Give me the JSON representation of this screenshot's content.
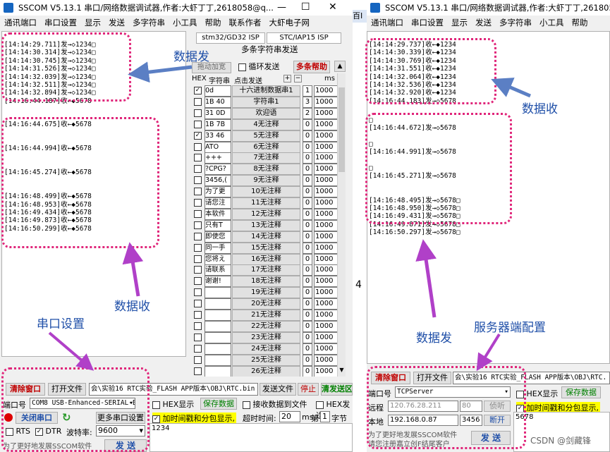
{
  "left": {
    "title": "SSCOM V5.13.1 串口/网络数据调试器,作者:大虾丁丁,2618058@q...",
    "menu": [
      "通讯端口",
      "串口设置",
      "显示",
      "发送",
      "多字符串",
      "小工具",
      "帮助",
      "联系作者",
      "大虾电子网"
    ],
    "log_top": [
      "[14:14:29.711]发→◇1234□",
      "[14:14:30.314]发→◇1234□",
      "[14:14:30.745]发→◇1234□",
      "[14:14:31.526]发→◇1234□",
      "[14:14:32.039]发→◇1234□",
      "[14:14:32.511]发→◇1234□",
      "[14:14:32.894]发→◇1234□",
      "[14:16:44.187]收←◆5678"
    ],
    "log_bottom": [
      "",
      "[14:16:44.675]收←◆5678",
      "",
      "",
      "[14:16:44.994]收←◆5678",
      "",
      "",
      "[14:16:45.274]收←◆5678",
      "",
      "",
      "[14:16:48.499]收←◆5678",
      "[14:16:48.953]收←◆5678",
      "[14:16:49.434]收←◆5678",
      "[14:16:49.873]收←◆5678",
      "[14:16:50.299]收←◆5678"
    ],
    "bottom": {
      "clear": "清除窗口",
      "open_file": "打开文件",
      "path": "会\\实验16 RTC实验_FLASH APP版本\\OBJ\\RTC.bin",
      "send_file": "发送文件",
      "stop": "停止",
      "clear_send": "清发送区",
      "port_label": "端口号",
      "port_value": "COM8 USB-Enhanced-SERIAL-B",
      "hex_display": "HEX显示",
      "save_data": "保存数据",
      "recv_to_file": "接收数据到文件",
      "hex_send": "HEX发送",
      "close_port": "关闭串口",
      "more_settings": "更多串口设置",
      "timestamp": "加时间戳和分包显示,",
      "timeout": "超时时间:",
      "timeout_val": "20",
      "ms": "ms",
      "nth": "第",
      "nth_val": "1",
      "byte": "字节",
      "rts": "RTS",
      "dtr": "DTR",
      "baud_label": "波特率:",
      "baud": "9600",
      "send_text": "1234",
      "promo": "为了更好地发展SSCOM软件",
      "send": "发 送"
    }
  },
  "multi": {
    "tab1": "stm32/GD32 ISP",
    "tab2": "STC/IAP15 ISP",
    "header": "多条字符串发送",
    "collapse": "拖动加宽",
    "loop": "循环发送",
    "help": "多条帮助",
    "col_hex": "HEX",
    "col_str": "字符串",
    "col_click": "点击发送",
    "col_ms": "ms",
    "rows": [
      {
        "chk": true,
        "text": "0d",
        "btn": "十六进制数据串1",
        "n": "1",
        "ms": "1000"
      },
      {
        "chk": false,
        "text": "1B 40",
        "btn": "字符串1",
        "n": "3",
        "ms": "1000"
      },
      {
        "chk": false,
        "text": "31 0D",
        "btn": "欢迎语",
        "n": "2",
        "ms": "1000"
      },
      {
        "chk": false,
        "text": "1B 7B",
        "btn": "4无注释",
        "n": "0",
        "ms": "1000"
      },
      {
        "chk": true,
        "text": "33 46",
        "btn": "5无注释",
        "n": "0",
        "ms": "1000"
      },
      {
        "chk": false,
        "text": "ATO",
        "btn": "6无注释",
        "n": "0",
        "ms": "1000"
      },
      {
        "chk": false,
        "text": "+++",
        "btn": "7无注释",
        "n": "0",
        "ms": "1000"
      },
      {
        "chk": false,
        "text": "?CPG?",
        "btn": "8无注释",
        "n": "0",
        "ms": "1000"
      },
      {
        "chk": false,
        "text": "3456,(",
        "btn": "9无注释",
        "n": "0",
        "ms": "1000"
      },
      {
        "chk": false,
        "text": "为了更",
        "btn": "10无注释",
        "n": "0",
        "ms": "1000"
      },
      {
        "chk": false,
        "text": "请您注",
        "btn": "11无注释",
        "n": "0",
        "ms": "1000"
      },
      {
        "chk": false,
        "text": "本软件",
        "btn": "12无注释",
        "n": "0",
        "ms": "1000"
      },
      {
        "chk": false,
        "text": "只有T",
        "btn": "13无注释",
        "n": "0",
        "ms": "1000"
      },
      {
        "chk": false,
        "text": "即使您",
        "btn": "14无注释",
        "n": "0",
        "ms": "1000"
      },
      {
        "chk": false,
        "text": "同一手",
        "btn": "15无注释",
        "n": "0",
        "ms": "1000"
      },
      {
        "chk": false,
        "text": "您将え",
        "btn": "16无注释",
        "n": "0",
        "ms": "1000"
      },
      {
        "chk": false,
        "text": "请联系",
        "btn": "17无注释",
        "n": "0",
        "ms": "1000"
      },
      {
        "chk": false,
        "text": "谢谢!",
        "btn": "18无注释",
        "n": "0",
        "ms": "1000"
      },
      {
        "chk": false,
        "text": "",
        "btn": "19无注释",
        "n": "0",
        "ms": "1000"
      },
      {
        "chk": false,
        "text": "",
        "btn": "20无注释",
        "n": "0",
        "ms": "1000"
      },
      {
        "chk": false,
        "text": "",
        "btn": "21无注释",
        "n": "0",
        "ms": "1000"
      },
      {
        "chk": false,
        "text": "",
        "btn": "22无注释",
        "n": "0",
        "ms": "1000"
      },
      {
        "chk": false,
        "text": "",
        "btn": "23无注释",
        "n": "0",
        "ms": "1000"
      },
      {
        "chk": false,
        "text": "",
        "btn": "24无注释",
        "n": "0",
        "ms": "1000"
      },
      {
        "chk": false,
        "text": "",
        "btn": "25无注释",
        "n": "0",
        "ms": "1000"
      },
      {
        "chk": false,
        "text": "",
        "btn": "26无注释",
        "n": "0",
        "ms": "1000"
      }
    ]
  },
  "mid": {
    "tab": "百I",
    "digit": "4"
  },
  "right": {
    "title": "SSCOM V5.13.1 串口/网络数据调试器,作者:大虾丁丁,2618058@",
    "menu": [
      "通讯端口",
      "串口设置",
      "显示",
      "发送",
      "多字符串",
      "小工具",
      "帮助"
    ],
    "log_top": [
      "[14:14:29.737]收←◆1234",
      "[14:14:30.339]收←◆1234",
      "[14:14:30.769]收←◆1234",
      "[14:14:31.551]收←◆1234",
      "[14:14:32.064]收←◆1234",
      "[14:14:32.536]收←◆1234",
      "[14:14:32.920]收←◆1234",
      "[14:16:44.183]发→◇5678"
    ],
    "log_bottom": [
      "",
      "□",
      "[14:16:44.672]发→◇5678",
      "",
      "□",
      "[14:16:44.991]发→◇5678",
      "",
      "□",
      "[14:16:45.271]发→◇5678",
      "",
      "",
      "[14:16:48.495]发→◇5678□",
      "[14:16:48.950]发→◇5678□",
      "[14:16:49.431]发→◇5678□",
      "[14:16:49.871]发→◇5678□",
      "[14:16:50.297]发→◇5678□"
    ],
    "bottom": {
      "clear": "清除窗口",
      "open_file": "打开文件",
      "path": "会\\实验16 RTC实验_FLASH APP版本\\OBJ\\RTC.",
      "port_label": "端口号",
      "port_value": "TCPServer",
      "hex_display": "HEX显示",
      "save_data": "保存数据",
      "remote": "远程",
      "remote_ip": "120.76.28.211",
      "remote_port": "80",
      "listen": "侦听",
      "timestamp": "加时间戳和分包显示,",
      "local": "本地",
      "local_ip": "192.168.0.87",
      "local_port": "3456",
      "disconnect": "断开",
      "send_text": "5678",
      "promo1": "为了更好地发展SSCOM软件",
      "promo2": "请您注册嘉立创F结尾客户",
      "send": "发 送"
    }
  },
  "annotations": {
    "left_send": "数据发",
    "left_recv": "数据收",
    "left_port": "串口设置",
    "right_recv": "数据收",
    "right_send": "数据发",
    "right_server": "服务器端配置"
  },
  "watermark": "CSDN @剑藏锋",
  "colors": {
    "highlight": "#e0267a",
    "label": "#1f4fa8",
    "arrow_blue": "#5b7fc4",
    "arrow_purple": "#b040c8",
    "warn": "#c00000",
    "save_green": "#008000"
  }
}
